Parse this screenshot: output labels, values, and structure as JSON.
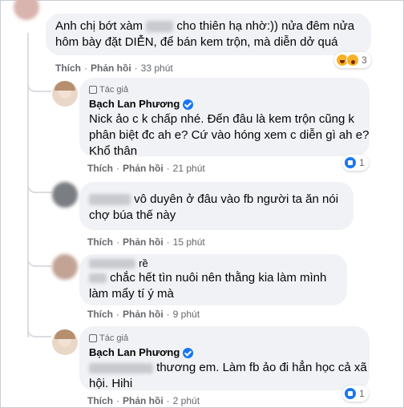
{
  "comments": [
    {
      "text_line1": "Anh chị bớt xàm",
      "blur_word": "",
      "text_line1_rest": "cho thiên hạ nhờ:)) nửa đêm nửa",
      "text_line2": "hôm bày đặt DIỄN, để bán kem trộn, mà diễn dở quá",
      "actions": {
        "like": "Thích",
        "reply": "Phản hồi",
        "time": "33 phút"
      },
      "reaction_count": "3"
    },
    {
      "badge": "Tác giả",
      "author": "Bạch Lan Phương",
      "lines": [
        "Nick ảo c k chấp nhé. Đến đâu là kem trộn cũng k",
        "phân biệt đc ah e? Cứ vào hóng xem c diễn gì ah e?",
        "Khổ thân"
      ],
      "actions": {
        "like": "Thích",
        "reply": "Phản hồi",
        "time": "21 phút"
      },
      "reaction_count": "1"
    },
    {
      "lines": [
        "vô duyên ở đâu vào fb người ta ăn nói",
        "chợ búa thế này"
      ],
      "actions": {
        "like": "Thích",
        "reply": "Phản hồi",
        "time": "15 phút"
      }
    },
    {
      "name_fragment": "rề",
      "lines": [
        "chắc hết tìn nuôi nên thằng kia làm mình",
        "làm mẩy tí ý mà"
      ],
      "actions": {
        "like": "Thích",
        "reply": "Phản hồi",
        "time": "9 phút"
      }
    },
    {
      "badge": "Tác giả",
      "author": "Bạch Lan Phương",
      "lines": [
        "thương em. Làm fb ảo đi hẳn học cả xã",
        "hội. Hihi"
      ],
      "actions": {
        "like": "Thích",
        "reply": "Phản hồi",
        "time": "2 phút"
      },
      "reaction_count": "1"
    }
  ],
  "colors": {
    "bubble": "#f0f2f5",
    "meta": "#65676b",
    "like_blue": "#1877f2"
  }
}
